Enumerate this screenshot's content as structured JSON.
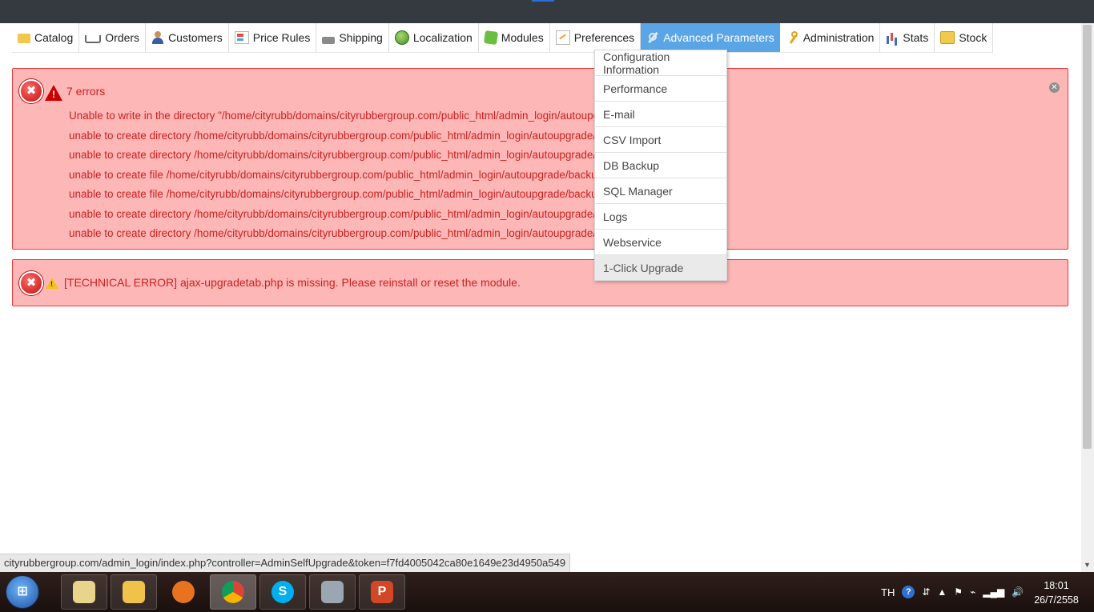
{
  "menu": {
    "items": [
      {
        "label": "Catalog",
        "icon": "folder-icon"
      },
      {
        "label": "Orders",
        "icon": "cart-icon"
      },
      {
        "label": "Customers",
        "icon": "customer-icon"
      },
      {
        "label": "Price Rules",
        "icon": "price-rules-icon"
      },
      {
        "label": "Shipping",
        "icon": "truck-icon"
      },
      {
        "label": "Localization",
        "icon": "globe-icon"
      },
      {
        "label": "Modules",
        "icon": "puzzle-icon"
      },
      {
        "label": "Preferences",
        "icon": "preferences-icon"
      },
      {
        "label": "Advanced Parameters",
        "icon": "wrench-icon"
      },
      {
        "label": "Administration",
        "icon": "key-icon"
      },
      {
        "label": "Stats",
        "icon": "bar-chart-icon"
      },
      {
        "label": "Stock",
        "icon": "stock-icon"
      }
    ],
    "active": "Advanced Parameters",
    "active_color": "#5aa5e6"
  },
  "dropdown": {
    "items": [
      "Configuration Information",
      "Performance",
      "E-mail",
      "CSV Import",
      "DB Backup",
      "SQL Manager",
      "Logs",
      "Webservice",
      "1-Click Upgrade"
    ],
    "highlighted": "1-Click Upgrade"
  },
  "errors": {
    "count_label": "7 errors",
    "messages": [
      "Unable to write in the directory \"/home/cityrubb/domains/cityrubbergroup.com/public_html/admin_login/autoupgrade\"",
      "unable to create directory /home/cityrubb/domains/cityrubbergroup.com/public_html/admin_login/autoupgrade/download",
      "unable to create directory /home/cityrubb/domains/cityrubbergroup.com/public_html/admin_login/autoupgrade/backup",
      "unable to create file /home/cityrubb/domains/cityrubbergroup.com/public_html/admin_login/autoupgrade/backup/index.ph",
      "unable to create file /home/cityrubb/domains/cityrubbergroup.com/public_html/admin_login/autoupgrade/backup/.htacces",
      "unable to create directory /home/cityrubb/domains/cityrubbergroup.com/public_html/admin_login/autoupgrade/latest",
      "unable to create directory /home/cityrubb/domains/cityrubbergroup.com/public_html/admin_login/autoupgrade/tmp"
    ],
    "bg_color": "#feb7b7",
    "text_color": "#cc1f1f"
  },
  "technical_error": {
    "message": "[TECHNICAL ERROR] ajax-upgradetab.php is missing. Please reinstall or reset the module."
  },
  "status_bar": {
    "url": "cityrubbergroup.com/admin_login/index.php?controller=AdminSelfUpgrade&token=f7fd4005042ca80e1649e23d4950a549"
  },
  "taskbar": {
    "apps": [
      {
        "name": "folder-app-icon",
        "glyph": "",
        "color": "#e8d48a",
        "active": false
      },
      {
        "name": "file-explorer-icon",
        "glyph": "",
        "color": "#f0c24a",
        "active": false
      },
      {
        "name": "firefox-icon",
        "glyph": "",
        "color": "#e8731e",
        "active": false
      },
      {
        "name": "chrome-icon",
        "glyph": "",
        "color": "#db4437",
        "active": true
      },
      {
        "name": "skype-icon",
        "glyph": "S",
        "color": "#00aff0",
        "active": false
      },
      {
        "name": "scanner-app-icon",
        "glyph": "",
        "color": "#9aa6b2",
        "active": false
      },
      {
        "name": "powerpoint-icon",
        "glyph": "P",
        "color": "#d24726",
        "active": false
      }
    ],
    "language": "TH",
    "time": "18:01",
    "date": "26/7/2558"
  }
}
